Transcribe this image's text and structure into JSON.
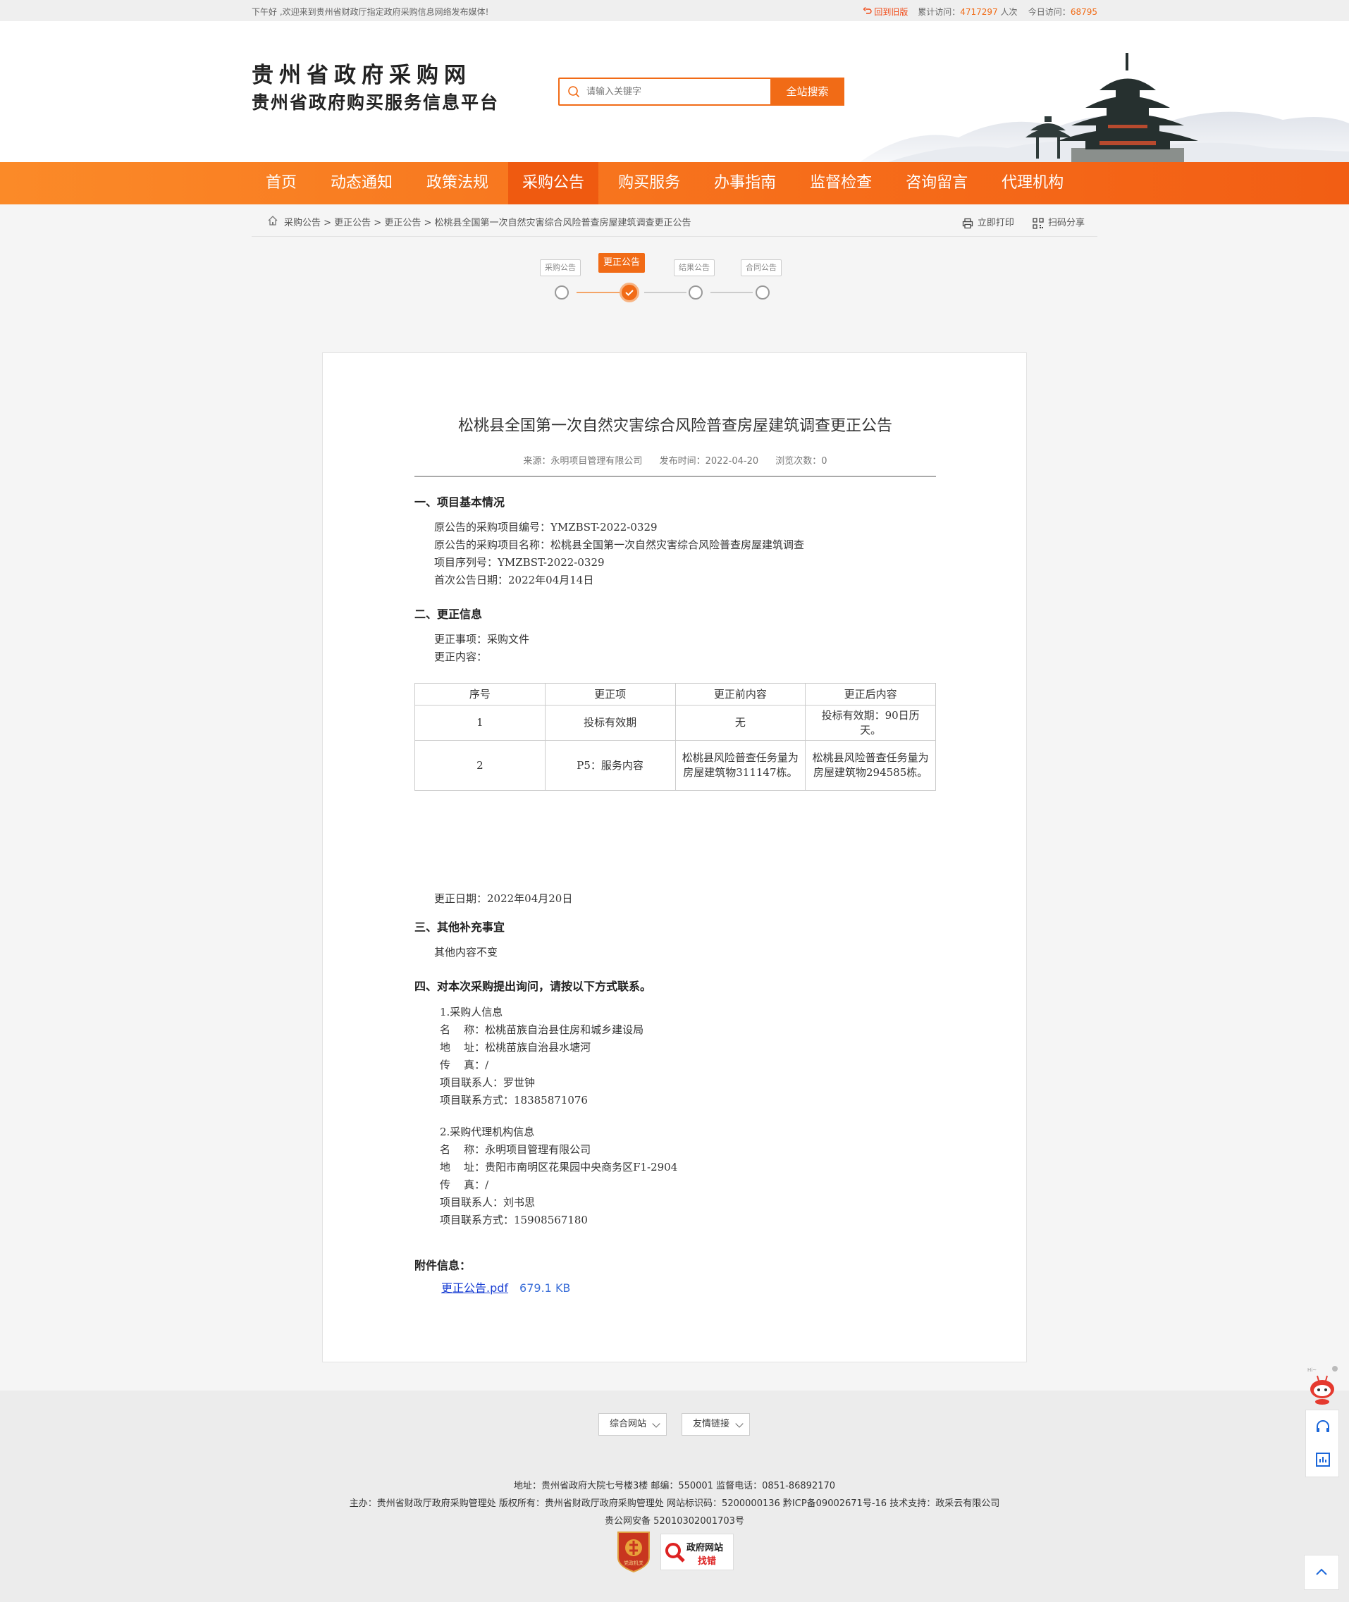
{
  "topbar": {
    "welcome": "下午好 ,欢迎来到贵州省财政厅指定政府采购信息网络发布媒体!",
    "old_site": "回到旧版",
    "total_label": "累计访问：",
    "total_value": "4717297",
    "total_unit": "人次",
    "today_label": "今日访问：",
    "today_value": "68795"
  },
  "brand": {
    "title": "贵州省政府采购网",
    "subtitle": "贵州省政府购买服务信息平台"
  },
  "search": {
    "placeholder": "请输入关键字",
    "button": "全站搜索"
  },
  "nav": {
    "items": [
      "首页",
      "动态通知",
      "政策法规",
      "采购公告",
      "购买服务",
      "办事指南",
      "监督检查",
      "咨询留言",
      "代理机构"
    ],
    "active": "采购公告"
  },
  "breadcrumb": {
    "path": "采购公告 > 更正公告 > 更正公告 > 松桃县全国第一次自然灾害综合风险普查房屋建筑调查更正公告",
    "print": "立即打印",
    "share": "扫码分享"
  },
  "steps": {
    "labels": [
      "采购公告",
      "更正公告",
      "结果公告",
      "合同公告"
    ],
    "active_index": 1
  },
  "article": {
    "title": "松桃县全国第一次自然灾害综合风险普查房屋建筑调查更正公告",
    "source": "来源：永明项目管理有限公司",
    "date": "发布时间：2022-04-20",
    "views": "浏览次数：0",
    "s1": {
      "heading": "一、项目基本情况",
      "lines": [
        "原公告的采购项目编号：YMZBST-2022-0329",
        "原公告的采购项目名称：松桃县全国第一次自然灾害综合风险普查房屋建筑调查",
        "项目序列号：YMZBST-2022-0329",
        "首次公告日期：2022年04月14日"
      ]
    },
    "s2": {
      "heading": "二、更正信息",
      "lines": [
        "更正事项：采购文件",
        "更正内容："
      ],
      "table": {
        "headers": [
          "序号",
          "更正项",
          "更正前内容",
          "更正后内容"
        ],
        "rows": [
          [
            "1",
            "投标有效期",
            "无",
            "投标有效期：90日历天。"
          ],
          [
            "2",
            "P5：服务内容",
            "松桃县风险普查任务量为房屋建筑物311147栋。",
            "松桃县风险普查任务量为房屋建筑物294585栋。"
          ]
        ]
      },
      "date": "更正日期：2022年04月20日"
    },
    "s3": {
      "heading": "三、其他补充事宜",
      "lines": [
        "其他内容不变"
      ]
    },
    "s4": {
      "heading": "四、对本次采购提出询问，请按以下方式联系。",
      "purchaser": [
        "1.采购人信息",
        "名    称：松桃苗族自治县住房和城乡建设局",
        "地    址：松桃苗族自治县水塘河",
        "传    真：/",
        "项目联系人：罗世钟",
        "项目联系方式：18385871076"
      ],
      "agency": [
        "2.采购代理机构信息",
        "名    称：永明项目管理有限公司",
        "地    址：贵阳市南明区花果园中央商务区F1-2904",
        "传    真：/",
        "项目联系人：刘书思",
        "项目联系方式：15908567180"
      ]
    },
    "attachment": {
      "heading": "附件信息：",
      "name": "更正公告.pdf",
      "size": "679.1 KB"
    }
  },
  "footer": {
    "select1": "综合网站",
    "select2": "友情链接",
    "line1": "地址：贵州省政府大院七号楼3楼    邮编：550001    监督电话：0851-86892170",
    "line2": "主办：贵州省财政厅政府采购管理处    版权所有：贵州省财政厅政府采购管理处    网站标识码：5200000136    黔ICP备09002671号-16    技术支持：政采云有限公司",
    "line3": "贵公网安备 52010302001703号",
    "badge1": "党政机关",
    "badge2_line1": "政府网站",
    "badge2_line2": "找错"
  },
  "side": {
    "hi": "Hi~"
  },
  "colors": {
    "accent": "#f16b16",
    "nav_active": "#ef5a10",
    "link": "#1a3fd3"
  }
}
